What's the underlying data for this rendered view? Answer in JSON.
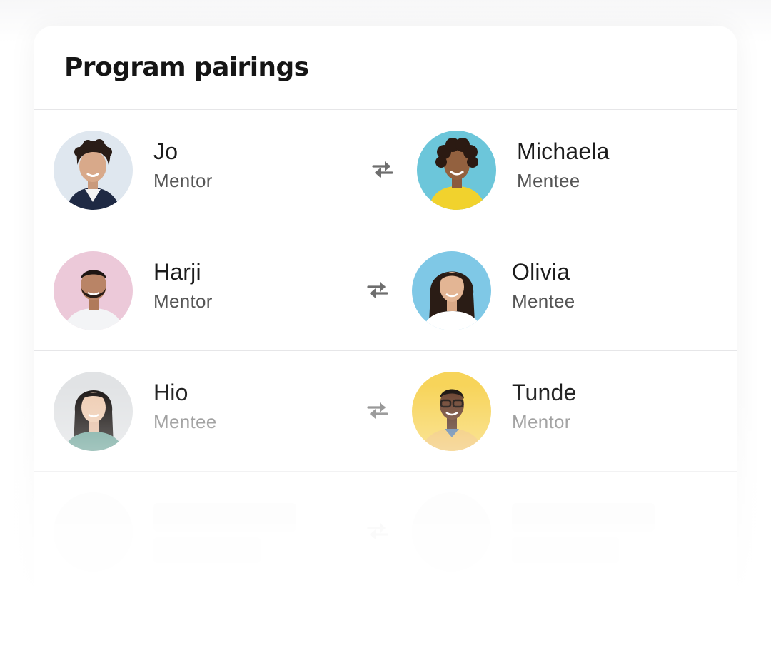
{
  "card": {
    "title": "Program pairings"
  },
  "pairings": [
    {
      "left": {
        "name": "Jo",
        "role": "Mentor",
        "avatar_bg": "#dfe7ef"
      },
      "right": {
        "name": "Michaela",
        "role": "Mentee",
        "avatar_bg": "#6cc6da"
      },
      "swap_icon": "swap-arrows-icon"
    },
    {
      "left": {
        "name": "Harji",
        "role": "Mentor",
        "avatar_bg": "#ecc9d9"
      },
      "right": {
        "name": "Olivia",
        "role": "Mentee",
        "avatar_bg": "#7fc8e6"
      },
      "swap_icon": "swap-arrows-icon"
    },
    {
      "left": {
        "name": "Hio",
        "role": "Mentee",
        "avatar_bg": "#e1e3e5"
      },
      "right": {
        "name": "Tunde",
        "role": "Mentor",
        "avatar_bg": "#f7d45a"
      },
      "swap_icon": "swap-arrows-icon"
    }
  ],
  "colors": {
    "title": "#151515",
    "name": "#1c1c1c",
    "role": "#555555",
    "role_muted": "#8c8c8c",
    "divider": "#e6e6e8",
    "swap_icon": "#6e6e6e"
  }
}
